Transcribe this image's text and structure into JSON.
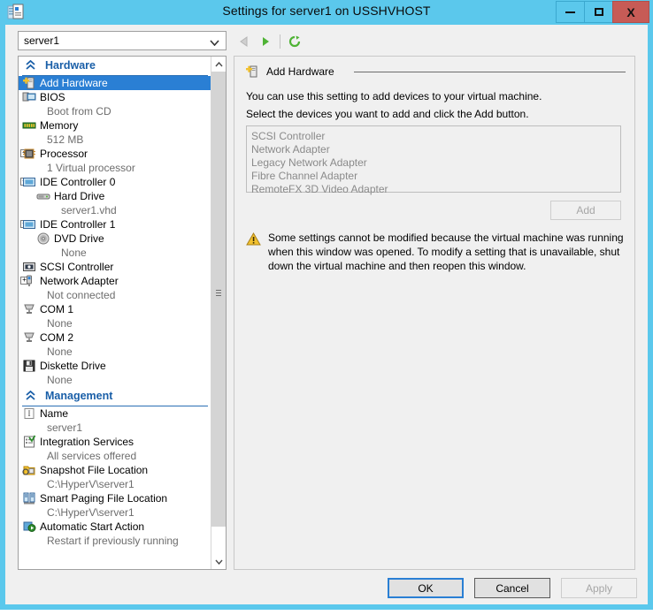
{
  "window": {
    "title": "Settings for server1 on USSHVHOST",
    "app_icon": "settings-document-icon",
    "minimize_label": "minimize-icon",
    "maximize_label": "maximize-icon",
    "close_label": "X",
    "accent": "#5bc8ec",
    "close_bg": "#c75b56"
  },
  "toolbar": {
    "vm_selected": "server1",
    "vm_dropdown_chevron": "chevron-down-icon",
    "back_icon": "back-arrow-icon",
    "forward_icon": "forward-arrow-icon",
    "refresh_icon": "refresh-icon"
  },
  "sidebar": {
    "groups": [
      {
        "label": "Hardware",
        "collapse_icon": "double-chevron-up-icon",
        "items": [
          {
            "label": "Add Hardware",
            "sub": "",
            "icon": "add-hardware-icon",
            "selected": true,
            "expander": ""
          },
          {
            "label": "BIOS",
            "sub": "Boot from CD",
            "icon": "bios-icon",
            "selected": false,
            "expander": ""
          },
          {
            "label": "Memory",
            "sub": "512 MB",
            "icon": "memory-icon",
            "selected": false,
            "expander": ""
          },
          {
            "label": "Processor",
            "sub": "1 Virtual processor",
            "icon": "processor-icon",
            "selected": false,
            "expander": "+"
          },
          {
            "label": "IDE Controller 0",
            "sub": "",
            "icon": "ide-controller-icon",
            "selected": false,
            "expander": "-"
          },
          {
            "label": "Hard Drive",
            "sub": "server1.vhd",
            "icon": "hard-drive-icon",
            "selected": false,
            "expander": "",
            "indent": true
          },
          {
            "label": "IDE Controller 1",
            "sub": "",
            "icon": "ide-controller-icon",
            "selected": false,
            "expander": "-"
          },
          {
            "label": "DVD Drive",
            "sub": "None",
            "icon": "dvd-drive-icon",
            "selected": false,
            "expander": "",
            "indent": true
          },
          {
            "label": "SCSI Controller",
            "sub": "",
            "icon": "scsi-controller-icon",
            "selected": false,
            "expander": ""
          },
          {
            "label": "Network Adapter",
            "sub": "Not connected",
            "icon": "network-adapter-icon",
            "selected": false,
            "expander": "+"
          },
          {
            "label": "COM 1",
            "sub": "None",
            "icon": "com-port-icon",
            "selected": false,
            "expander": ""
          },
          {
            "label": "COM 2",
            "sub": "None",
            "icon": "com-port-icon",
            "selected": false,
            "expander": ""
          },
          {
            "label": "Diskette Drive",
            "sub": "None",
            "icon": "diskette-drive-icon",
            "selected": false,
            "expander": ""
          }
        ]
      },
      {
        "label": "Management",
        "collapse_icon": "double-chevron-up-icon",
        "items": [
          {
            "label": "Name",
            "sub": "server1",
            "icon": "name-icon",
            "selected": false,
            "expander": ""
          },
          {
            "label": "Integration Services",
            "sub": "All services offered",
            "icon": "integration-services-icon",
            "selected": false,
            "expander": ""
          },
          {
            "label": "Snapshot File Location",
            "sub": "C:\\HyperV\\server1",
            "icon": "snapshot-folder-icon",
            "selected": false,
            "expander": ""
          },
          {
            "label": "Smart Paging File Location",
            "sub": "C:\\HyperV\\server1",
            "icon": "smart-paging-icon",
            "selected": false,
            "expander": ""
          },
          {
            "label": "Automatic Start Action",
            "sub": "Restart if previously running",
            "icon": "automatic-start-icon",
            "selected": false,
            "expander": ""
          }
        ]
      }
    ]
  },
  "pane": {
    "group_title": "Add Hardware",
    "group_icon": "add-hardware-icon",
    "line1": "You can use this setting to add devices to your virtual machine.",
    "line2": "Select the devices you want to add and click the Add button.",
    "devices": [
      "SCSI Controller",
      "Network Adapter",
      "Legacy Network Adapter",
      "Fibre Channel Adapter",
      "RemoteFX 3D Video Adapter"
    ],
    "add_button": "Add",
    "warning_icon": "warning-triangle-icon",
    "warning_text": "Some settings cannot be modified because the virtual machine was running when this window was opened. To modify a setting that is unavailable, shut down the virtual machine and then reopen this window."
  },
  "footer": {
    "ok": "OK",
    "cancel": "Cancel",
    "apply": "Apply"
  }
}
